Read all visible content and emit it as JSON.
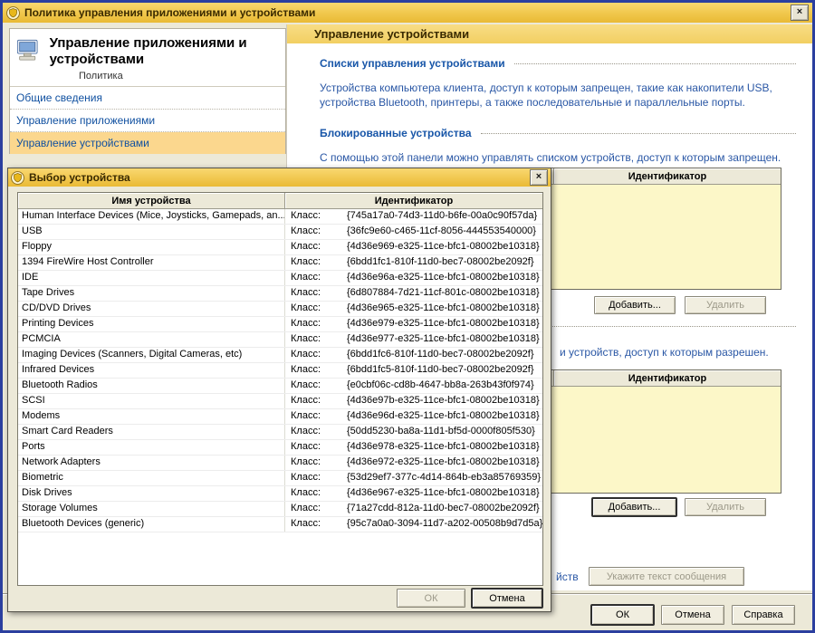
{
  "colors": {
    "titlebar_gold": "#F0C74B",
    "band_gold": "#F5D678",
    "window_border_blue": "#2B3F9F",
    "link_blue": "#1856A8",
    "body_text_blue": "#2A57A5",
    "sidebar_highlight": "#FBD78E",
    "listbox_yellow": "#FCF7C8",
    "dialog_chrome": "#ECE9D8"
  },
  "window": {
    "title": "Политика управления приложениями и устройствами",
    "close_glyph": "×"
  },
  "sidebar": {
    "heading": "Управление приложениями и устройствами",
    "subtitle": "Политика",
    "items": [
      {
        "label": "Общие сведения"
      },
      {
        "label": "Управление приложениями"
      },
      {
        "label": "Управление устройствами"
      }
    ]
  },
  "content": {
    "header": "Управление устройствами",
    "section1_title": "Списки управления устройствами",
    "section1_text": "Устройства компьютера клиента, доступ к которым запрещен, такие как накопители USB, устройства Bluetooth, принтеры, а также последовательные и параллельные порты.",
    "section2_title": "Блокированные устройства",
    "section2_text": "С помощью этой панели можно управлять списком устройств, доступ к которым запрещен.",
    "blocked_list": {
      "id_column": "Идентификатор",
      "add_label": "Добавить...",
      "remove_label": "Удалить"
    },
    "allowed_intro_fragment": "и устройств, доступ к которым разрешен.",
    "allowed_list": {
      "id_column": "Идентификатор",
      "add_label": "Добавить...",
      "remove_label": "Удалить"
    },
    "notify_fragment": "йств",
    "notify_button": "Укажите текст сообщения"
  },
  "footer": {
    "ok": "ОК",
    "cancel": "Отмена",
    "help": "Справка"
  },
  "device_dialog": {
    "title": "Выбор устройства",
    "close_glyph": "×",
    "columns": {
      "name": "Имя устройства",
      "id": "Идентификатор"
    },
    "class_label": "Класс:",
    "rows": [
      {
        "name": "Human Interface Devices (Mice, Joysticks, Gamepads, an...",
        "class_label": "Класс:",
        "guid": "{745a17a0-74d3-11d0-b6fe-00a0c90f57da}"
      },
      {
        "name": "USB",
        "class_label": "Класс:",
        "guid": "{36fc9e60-c465-11cf-8056-444553540000}"
      },
      {
        "name": "Floppy",
        "class_label": "Класс:",
        "guid": "{4d36e969-e325-11ce-bfc1-08002be10318}"
      },
      {
        "name": "1394 FireWire Host Controller",
        "class_label": "Класс:",
        "guid": "{6bdd1fc1-810f-11d0-bec7-08002be2092f}"
      },
      {
        "name": "IDE",
        "class_label": "Класс:",
        "guid": "{4d36e96a-e325-11ce-bfc1-08002be10318}"
      },
      {
        "name": "Tape Drives",
        "class_label": "Класс:",
        "guid": "{6d807884-7d21-11cf-801c-08002be10318}"
      },
      {
        "name": "CD/DVD Drives",
        "class_label": "Класс:",
        "guid": "{4d36e965-e325-11ce-bfc1-08002be10318}"
      },
      {
        "name": "Printing Devices",
        "class_label": "Класс:",
        "guid": "{4d36e979-e325-11ce-bfc1-08002be10318}"
      },
      {
        "name": "PCMCIA",
        "class_label": "Класс:",
        "guid": "{4d36e977-e325-11ce-bfc1-08002be10318}"
      },
      {
        "name": "Imaging Devices (Scanners, Digital Cameras, etc)",
        "class_label": "Класс:",
        "guid": "{6bdd1fc6-810f-11d0-bec7-08002be2092f}"
      },
      {
        "name": "Infrared Devices",
        "class_label": "Класс:",
        "guid": "{6bdd1fc5-810f-11d0-bec7-08002be2092f}"
      },
      {
        "name": "Bluetooth Radios",
        "class_label": "Класс:",
        "guid": "{e0cbf06c-cd8b-4647-bb8a-263b43f0f974}"
      },
      {
        "name": "SCSI",
        "class_label": "Класс:",
        "guid": "{4d36e97b-e325-11ce-bfc1-08002be10318}"
      },
      {
        "name": "Modems",
        "class_label": "Класс:",
        "guid": "{4d36e96d-e325-11ce-bfc1-08002be10318}"
      },
      {
        "name": "Smart Card Readers",
        "class_label": "Класс:",
        "guid": "{50dd5230-ba8a-11d1-bf5d-0000f805f530}"
      },
      {
        "name": "Ports",
        "class_label": "Класс:",
        "guid": "{4d36e978-e325-11ce-bfc1-08002be10318}"
      },
      {
        "name": "Network Adapters",
        "class_label": "Класс:",
        "guid": "{4d36e972-e325-11ce-bfc1-08002be10318}"
      },
      {
        "name": "Biometric",
        "class_label": "Класс:",
        "guid": "{53d29ef7-377c-4d14-864b-eb3a85769359}"
      },
      {
        "name": "Disk Drives",
        "class_label": "Класс:",
        "guid": "{4d36e967-e325-11ce-bfc1-08002be10318}"
      },
      {
        "name": "Storage Volumes",
        "class_label": "Класс:",
        "guid": "{71a27cdd-812a-11d0-bec7-08002be2092f}"
      },
      {
        "name": "Bluetooth Devices (generic)",
        "class_label": "Класс:",
        "guid": "{95c7a0a0-3094-11d7-a202-00508b9d7d5a}"
      }
    ],
    "ok": "ОК",
    "cancel": "Отмена"
  }
}
